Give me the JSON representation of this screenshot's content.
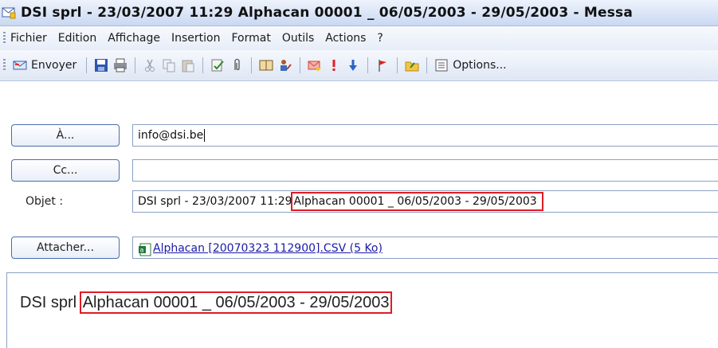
{
  "window": {
    "title": "DSI sprl - 23/03/2007 11:29 Alphacan 00001 _ 06/05/2003 - 29/05/2003 - Messa"
  },
  "menu": {
    "items": [
      "Fichier",
      "Edition",
      "Affichage",
      "Insertion",
      "Format",
      "Outils",
      "Actions",
      "?"
    ]
  },
  "toolbar": {
    "send_label": "Envoyer",
    "options_label": "Options...",
    "icons": [
      "send-icon",
      "save-icon",
      "print-icon",
      "cut-icon",
      "copy-icon",
      "paste-icon",
      "check-names-icon",
      "attach-icon",
      "address-book-icon",
      "permissions-icon",
      "flag-icon",
      "high-importance-icon",
      "low-importance-icon",
      "follow-up-icon",
      "folder-icon",
      "options-icon"
    ]
  },
  "fields": {
    "to_button": "À...",
    "to_value": "info@dsi.be",
    "cc_button": "Cc...",
    "cc_value": "",
    "subject_label": "Objet :",
    "subject_prefix": "DSI sprl - 23/03/2007 11:29",
    "subject_highlight": "Alphacan 00001 _ 06/05/2003 - 29/05/2003",
    "attach_button": "Attacher...",
    "attachment_name": "Alphacan [20070323 112900].CSV (5 Ko)"
  },
  "body": {
    "prefix": "DSI sprl",
    "highlight": "Alphacan 00001 _ 06/05/2003 - 29/05/2003"
  },
  "colors": {
    "highlight_box": "#e01b24",
    "link": "#1a1aa8",
    "button_border": "#4a6fa8"
  }
}
